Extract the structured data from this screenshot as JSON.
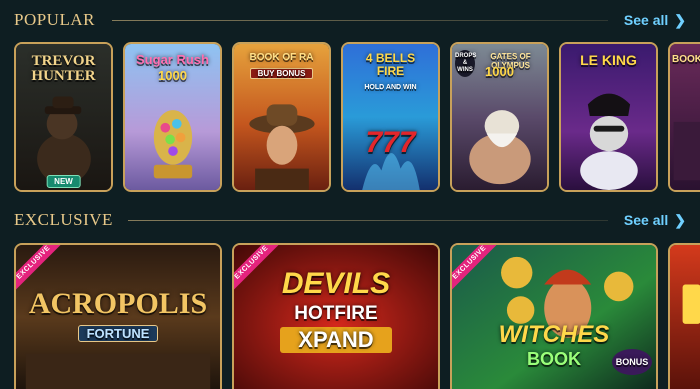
{
  "popular": {
    "title": "POPULAR",
    "see_all": "See all",
    "games": [
      {
        "title": "TREVOR HUNTER",
        "badge": "NEW"
      },
      {
        "title": "Sugar Rush",
        "subtitle": "1000"
      },
      {
        "title": "BOOK OF RA",
        "subtitle": "BUY BONUS"
      },
      {
        "title": "4 BELLS FIRE",
        "subtitle": "HOLD AND WIN",
        "extra": "777"
      },
      {
        "title": "GATES OF OLYMPUS",
        "subtitle": "1000",
        "tag": "DROPS & WINS"
      },
      {
        "title": "LE KING"
      },
      {
        "title": "BOOK THE"
      }
    ]
  },
  "exclusive": {
    "title": "EXCLUSIVE",
    "see_all": "See all",
    "ribbon": "EXCLUSIVE",
    "games": [
      {
        "title": "ACROPOLIS",
        "subtitle": "FORTUNE"
      },
      {
        "title": "DEVILS",
        "subtitle": "HOTFIRE",
        "extra": "XPAND"
      },
      {
        "title": "WITCHES",
        "subtitle": "BOOK",
        "extra": "BONUS"
      }
    ]
  },
  "colors": {
    "background": "#0e1e22",
    "gold": "#e8c98a",
    "link": "#6fd0ff",
    "ribbon": "#e4237d"
  }
}
